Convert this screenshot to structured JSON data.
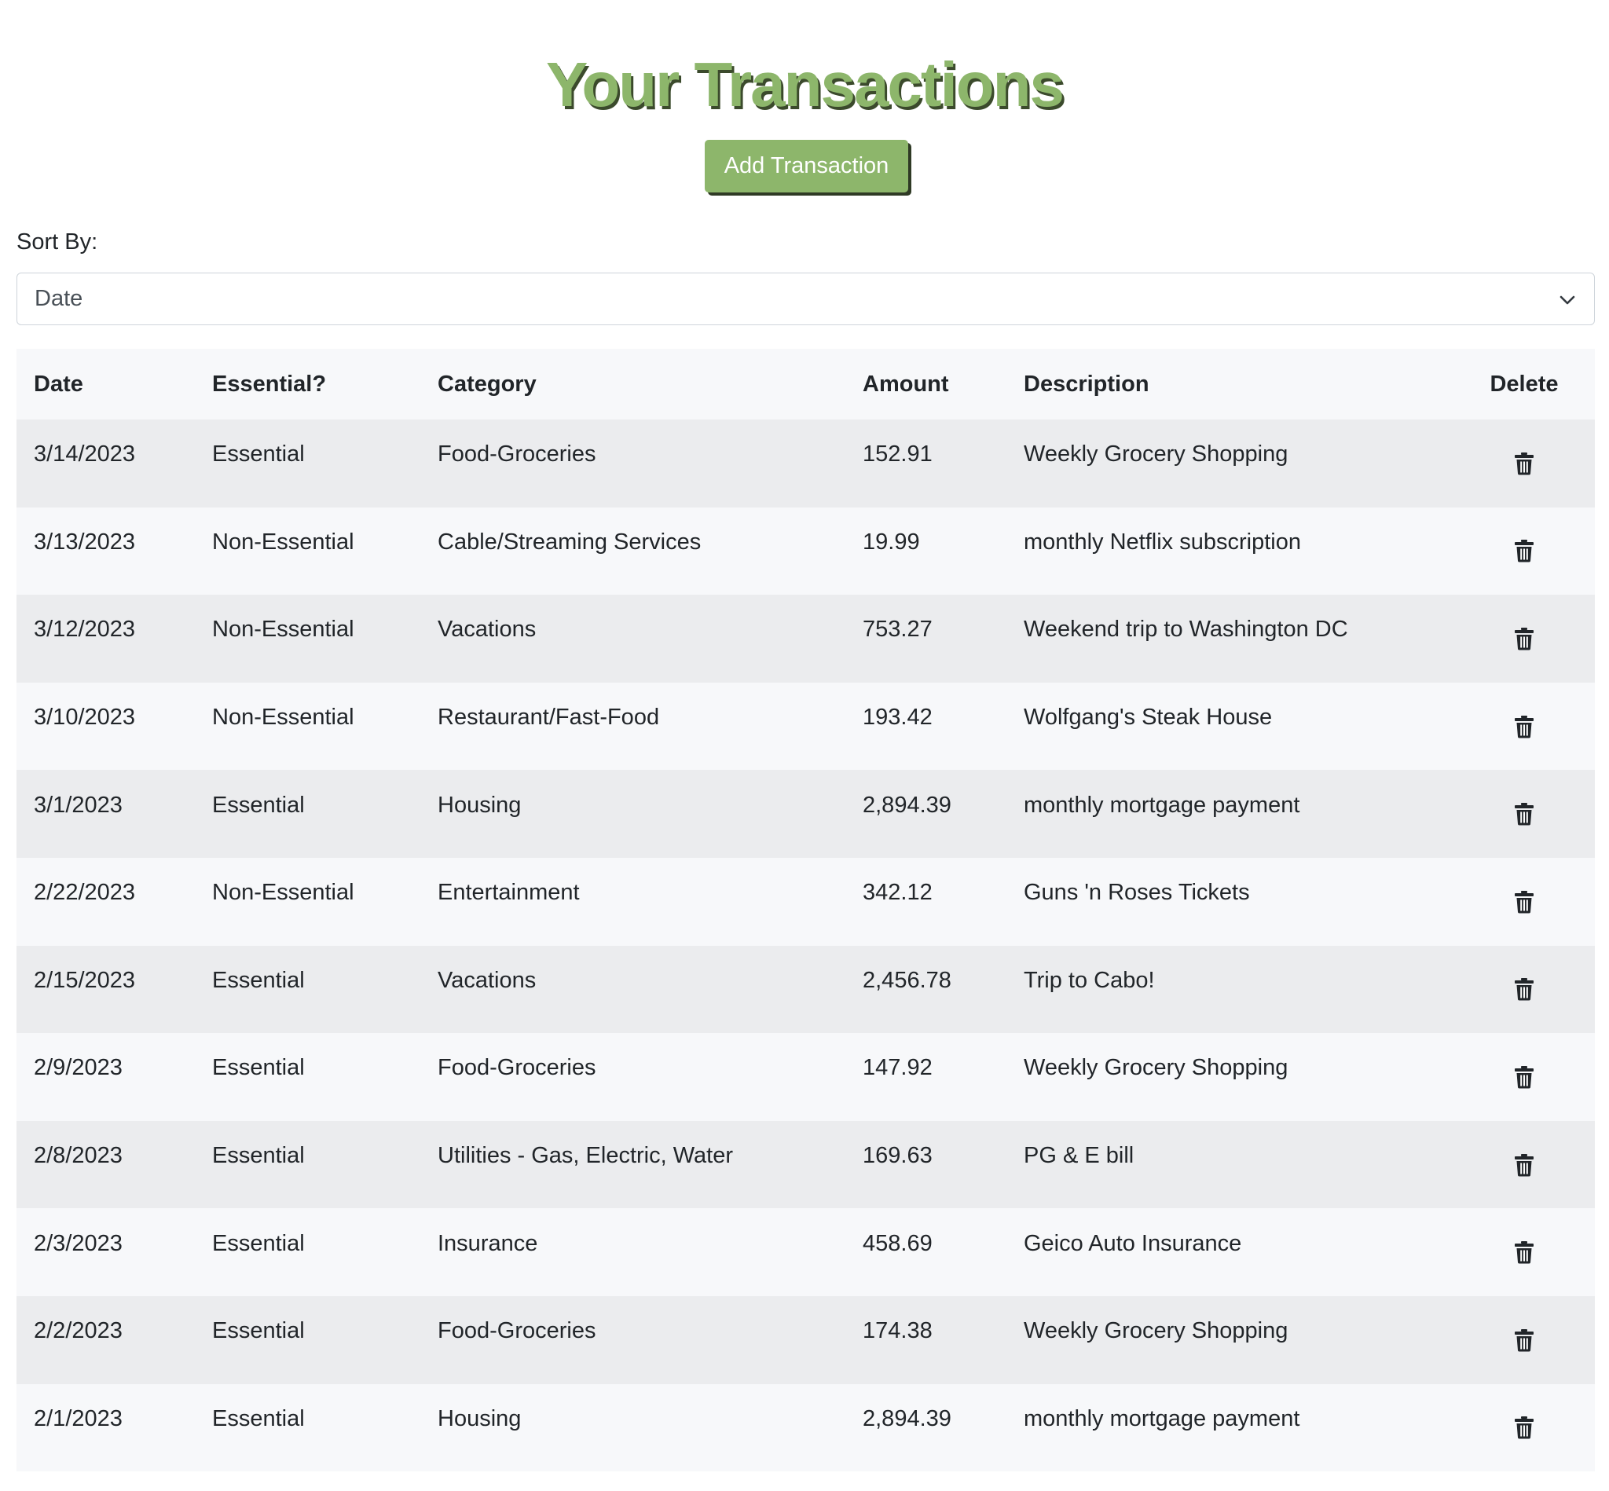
{
  "page_title": "Your Transactions",
  "add_button_label": "Add Transaction",
  "sort": {
    "label": "Sort By:",
    "selected": "Date"
  },
  "table": {
    "headers": [
      "Date",
      "Essential?",
      "Category",
      "Amount",
      "Description",
      "Delete"
    ],
    "rows": [
      {
        "date": "3/14/2023",
        "essential": "Essential",
        "category": "Food-Groceries",
        "amount": "152.91",
        "description": "Weekly Grocery Shopping"
      },
      {
        "date": "3/13/2023",
        "essential": "Non-Essential",
        "category": "Cable/Streaming Services",
        "amount": "19.99",
        "description": "monthly Netflix subscription"
      },
      {
        "date": "3/12/2023",
        "essential": "Non-Essential",
        "category": "Vacations",
        "amount": "753.27",
        "description": "Weekend trip to Washington DC"
      },
      {
        "date": "3/10/2023",
        "essential": "Non-Essential",
        "category": "Restaurant/Fast-Food",
        "amount": "193.42",
        "description": "Wolfgang's Steak House"
      },
      {
        "date": "3/1/2023",
        "essential": "Essential",
        "category": "Housing",
        "amount": "2,894.39",
        "description": "monthly mortgage payment"
      },
      {
        "date": "2/22/2023",
        "essential": "Non-Essential",
        "category": "Entertainment",
        "amount": "342.12",
        "description": "Guns 'n Roses Tickets"
      },
      {
        "date": "2/15/2023",
        "essential": "Essential",
        "category": "Vacations",
        "amount": "2,456.78",
        "description": "Trip to Cabo!"
      },
      {
        "date": "2/9/2023",
        "essential": "Essential",
        "category": "Food-Groceries",
        "amount": "147.92",
        "description": "Weekly Grocery Shopping"
      },
      {
        "date": "2/8/2023",
        "essential": "Essential",
        "category": "Utilities - Gas, Electric, Water",
        "amount": "169.63",
        "description": "PG & E bill"
      },
      {
        "date": "2/3/2023",
        "essential": "Essential",
        "category": "Insurance",
        "amount": "458.69",
        "description": "Geico Auto Insurance"
      },
      {
        "date": "2/2/2023",
        "essential": "Essential",
        "category": "Food-Groceries",
        "amount": "174.38",
        "description": "Weekly Grocery Shopping"
      },
      {
        "date": "2/1/2023",
        "essential": "Essential",
        "category": "Housing",
        "amount": "2,894.39",
        "description": "monthly mortgage payment"
      }
    ],
    "delete_icon": "trash-icon"
  },
  "colors": {
    "accent": "#8db66b",
    "title_shadow": "#3b4a2c",
    "row_odd": "#ebecee",
    "row_even": "#f7f8fa"
  }
}
